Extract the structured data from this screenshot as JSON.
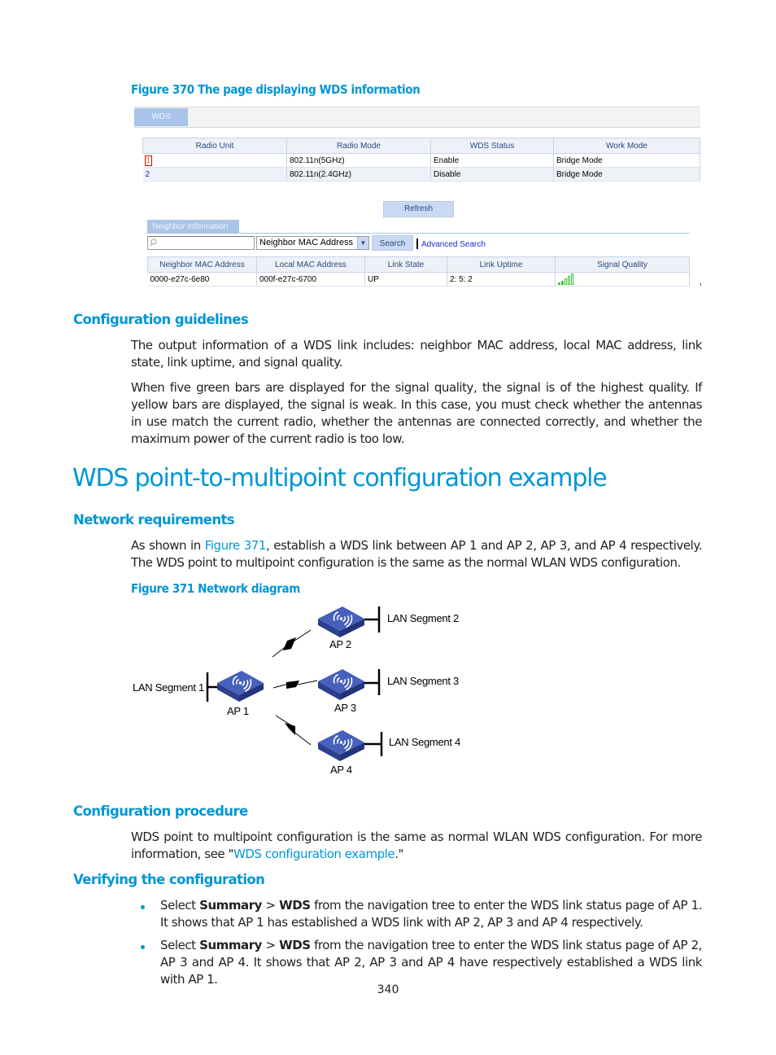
{
  "figure370": {
    "caption": "Figure 370 The page displaying WDS information",
    "tab_label": "WDS",
    "radio_table": {
      "headers": [
        "Radio Unit",
        "Radio Mode",
        "WDS Status",
        "Work Mode"
      ],
      "rows": [
        {
          "radio_unit": "1",
          "radio_mode": "802.11n(5GHz)",
          "wds_status": "Enable",
          "work_mode": "Bridge Mode"
        },
        {
          "radio_unit": "2",
          "radio_mode": "802.11n(2.4GHz)",
          "wds_status": "Disable",
          "work_mode": "Bridge Mode"
        }
      ]
    },
    "refresh_label": "Refresh",
    "neighbor_tab_label": "Neighbor Information",
    "search": {
      "input_value": "",
      "select_value": "Neighbor MAC Address",
      "search_label": "Search",
      "advanced_label": "Advanced Search"
    },
    "neighbor_table": {
      "headers": [
        "Neighbor MAC Address",
        "Local MAC Address",
        "Link State",
        "Link Uptime",
        "Signal Quality"
      ],
      "rows": [
        {
          "neighbor_mac": "0000-e27c-6e80",
          "local_mac": "000f-e27c-6700",
          "link_state": "UP",
          "link_uptime": "2: 5: 2",
          "signal_bars": 5
        }
      ]
    },
    "colors": {
      "tab": "#a9c4e8",
      "button": "#c9d9f3",
      "signal": "#3ec43e",
      "link": "#1e2bd0"
    }
  },
  "guidelines": {
    "heading": "Configuration guidelines",
    "p1": "The output information of a WDS link includes: neighbor MAC address, local MAC address, link state, link uptime, and signal quality.",
    "p2": "When five green bars are displayed for the signal quality, the signal is of the highest quality. If yellow bars are displayed, the signal is weak. In this case, you must check whether the antennas in use match the current radio, whether the antennas are connected correctly, and whether the maximum power of the current radio is too low."
  },
  "example": {
    "title": "WDS point-to-multipoint configuration example",
    "network_requirements": {
      "heading": "Network requirements",
      "p_before_link": "As shown in ",
      "link": "Figure 371",
      "p_after_link": ", establish a WDS link between AP 1 and AP 2, AP 3, and AP 4 respectively. The WDS point to multipoint configuration is the same as the normal WLAN WDS configuration."
    },
    "figure371": {
      "caption": "Figure 371 Network diagram",
      "nodes": [
        {
          "name": "AP 1",
          "segment": "LAN Segment 1"
        },
        {
          "name": "AP 2",
          "segment": "LAN Segment 2"
        },
        {
          "name": "AP 3",
          "segment": "LAN Segment 3"
        },
        {
          "name": "AP 4",
          "segment": "LAN Segment 4"
        }
      ],
      "links": [
        [
          "AP 1",
          "AP 2"
        ],
        [
          "AP 1",
          "AP 3"
        ],
        [
          "AP 1",
          "AP 4"
        ]
      ],
      "colors": {
        "ap": "#3550a8",
        "ap_top": "#4a66c0",
        "ap_side": "#2b3f8c"
      }
    },
    "procedure": {
      "heading": "Configuration procedure",
      "p_before_link": "WDS point to multipoint configuration is the same as normal WLAN WDS configuration. For more information, see \"",
      "link": "WDS configuration example",
      "p_after_link": ".\""
    },
    "verifying": {
      "heading": "Verifying the configuration",
      "bullets": [
        {
          "pre": "Select ",
          "b1": "Summary",
          "mid": " > ",
          "b2": "WDS",
          "post": " from the navigation tree to enter the WDS link status page of AP 1. It shows that AP 1 has established a WDS link with AP 2, AP 3 and AP 4 respectively."
        },
        {
          "pre": "Select ",
          "b1": "Summary",
          "mid": " > ",
          "b2": "WDS",
          "post": " from the navigation tree to enter the WDS link status page of AP 2, AP 3 and AP 4. It shows that AP 2, AP 3 and AP 4 have respectively established a WDS link with AP 1."
        }
      ]
    }
  },
  "page_number": "340"
}
